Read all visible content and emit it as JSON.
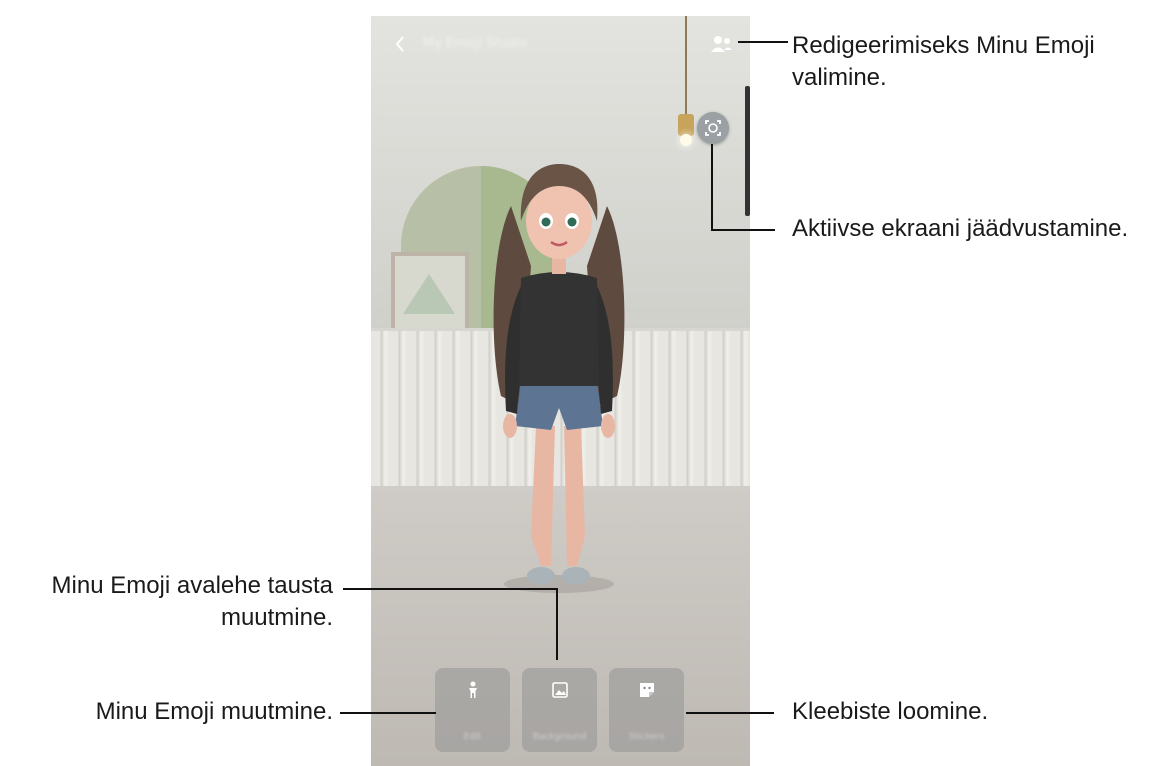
{
  "screen": {
    "title": "My Emoji Studio",
    "back_icon": "chevron-left-icon",
    "profile_icon": "people-icon",
    "capture_icon": "face-capture-icon",
    "tools": [
      {
        "icon": "person-icon",
        "label": "Edit"
      },
      {
        "icon": "image-icon",
        "label": "Background"
      },
      {
        "icon": "sticker-icon",
        "label": "Stickers"
      }
    ]
  },
  "callouts": {
    "select_emoji": "Redigeerimiseks Minu Emoji valimine.",
    "capture": "Aktiivse ekraani jäädvustamine.",
    "change_background_line1": "Minu Emoji avalehe tausta",
    "change_background_line2": "muutmine.",
    "edit_emoji": "Minu Emoji muutmine.",
    "create_stickers": "Kleebiste loomine."
  },
  "colors": {
    "leader_line": "#111111",
    "button_bg": "#969696"
  }
}
